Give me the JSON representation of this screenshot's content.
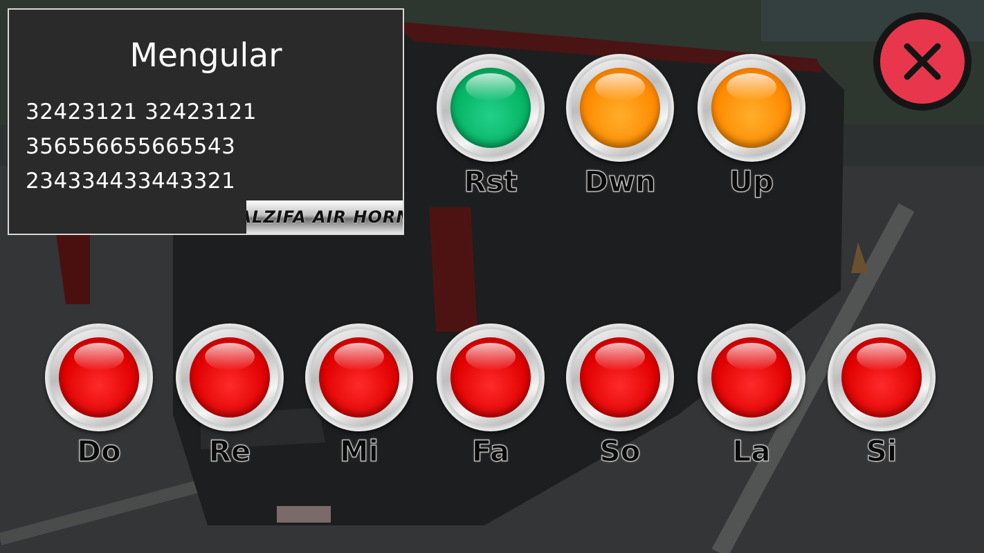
{
  "song": {
    "title": "Mengular",
    "notes": [
      "32423121 32423121",
      "356556655665543",
      "234334433443321"
    ]
  },
  "brand": {
    "logo_text": "ALZIFA AIR HORN"
  },
  "controls": [
    {
      "label": "Rst",
      "color": "#05b364"
    },
    {
      "label": "Dwn",
      "color": "#ff8a00"
    },
    {
      "label": "Up",
      "color": "#ff8a00"
    }
  ],
  "keys": [
    {
      "label": "Do",
      "color": "#e00000"
    },
    {
      "label": "Re",
      "color": "#e00000"
    },
    {
      "label": "Mi",
      "color": "#e00000"
    },
    {
      "label": "Fa",
      "color": "#e00000"
    },
    {
      "label": "So",
      "color": "#e00000"
    },
    {
      "label": "La",
      "color": "#e00000"
    },
    {
      "label": "Si",
      "color": "#e00000"
    }
  ],
  "close_button": {
    "icon": "close-icon",
    "color": "#e8374c"
  },
  "background": {
    "image": "bus-parking-lot"
  }
}
